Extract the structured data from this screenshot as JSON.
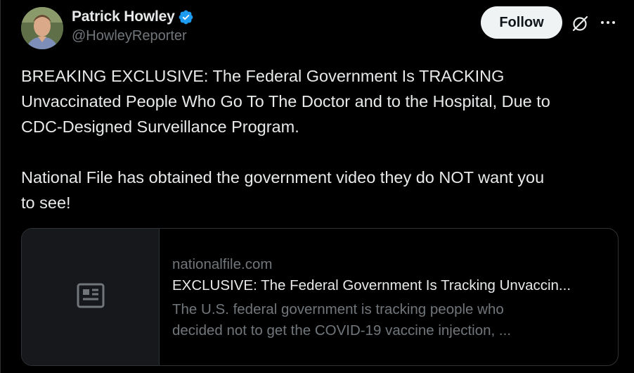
{
  "author": {
    "display_name": "Patrick Howley",
    "handle": "@HowleyReporter",
    "verified": true
  },
  "actions": {
    "follow_label": "Follow"
  },
  "tweet": {
    "text": "BREAKING EXCLUSIVE: The Federal Government Is TRACKING\nUnvaccinated People Who Go To The Doctor and to the Hospital, Due to\nCDC-Designed Surveillance Program.\n\nNational File has obtained the government video they do NOT want you\nto see!"
  },
  "link_card": {
    "domain": "nationalfile.com",
    "title": "EXCLUSIVE: The Federal Government Is Tracking Unvaccin...",
    "description_line1": "The U.S. federal government is tracking people who",
    "description_line2": "decided not to get the COVID-19 vaccine injection, ...",
    "thumbnail_icon": "article-icon"
  },
  "colors": {
    "background": "#000000",
    "text_primary": "#e7e9ea",
    "text_secondary": "#71767b",
    "verified_blue": "#1d9bf0",
    "border": "#2f3336",
    "follow_bg": "#eff3f4"
  }
}
